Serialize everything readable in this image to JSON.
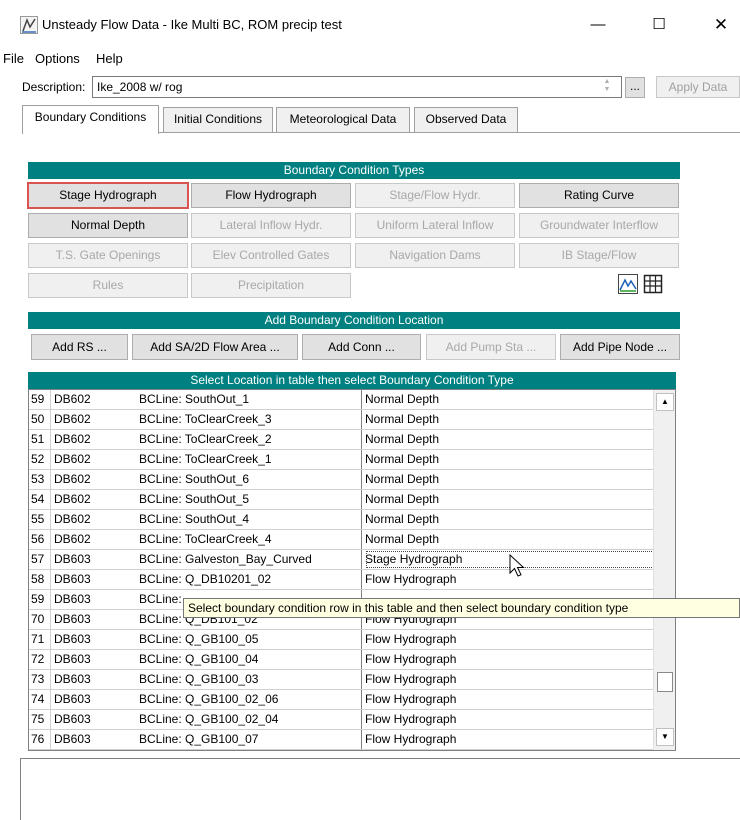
{
  "window": {
    "title": "Unsteady Flow Data - Ike Multi BC, ROM precip test",
    "minimize": "—",
    "maximize": "☐",
    "close": "✕"
  },
  "menu": [
    {
      "label": "File"
    },
    {
      "label": "Options"
    },
    {
      "label": "Help"
    }
  ],
  "description": {
    "label": "Description:",
    "value": "Ike_2008 w/ rog",
    "ellipsis_label": "...",
    "apply_label": "Apply Data"
  },
  "tabs": [
    {
      "label": "Boundary Conditions",
      "active": true
    },
    {
      "label": "Initial Conditions"
    },
    {
      "label": "Meteorological Data"
    },
    {
      "label": "Observed Data"
    }
  ],
  "bc_types": {
    "header": "Boundary Condition Types",
    "buttons": [
      {
        "label": "Stage Hydrograph",
        "enabled": true,
        "selected": true
      },
      {
        "label": "Flow Hydrograph",
        "enabled": true
      },
      {
        "label": "Stage/Flow Hydr.",
        "enabled": false
      },
      {
        "label": "Rating Curve",
        "enabled": true
      },
      {
        "label": "Normal Depth",
        "enabled": true
      },
      {
        "label": "Lateral Inflow Hydr.",
        "enabled": false
      },
      {
        "label": "Uniform Lateral Inflow",
        "enabled": false
      },
      {
        "label": "Groundwater Interflow",
        "enabled": false
      },
      {
        "label": "T.S. Gate Openings",
        "enabled": false
      },
      {
        "label": "Elev Controlled Gates",
        "enabled": false
      },
      {
        "label": "Navigation Dams",
        "enabled": false
      },
      {
        "label": "IB Stage/Flow",
        "enabled": false
      },
      {
        "label": "Rules",
        "enabled": false
      },
      {
        "label": "Precipitation",
        "enabled": false
      }
    ],
    "icons": [
      "hydrograph-plot-icon",
      "table-icon"
    ]
  },
  "add_location": {
    "header": "Add Boundary Condition Location",
    "buttons": [
      {
        "label": "Add RS ...",
        "enabled": true
      },
      {
        "label": "Add SA/2D Flow Area ...",
        "enabled": true
      },
      {
        "label": "Add Conn ...",
        "enabled": true
      },
      {
        "label": "Add Pump Sta ...",
        "enabled": false
      },
      {
        "label": "Add Pipe Node ...",
        "enabled": true
      }
    ]
  },
  "table": {
    "header": "Select Location in table then select Boundary Condition Type",
    "rows": [
      {
        "num": "59",
        "river": "DB602",
        "location": "BCLine: SouthOut_1",
        "bc": "Normal Depth"
      },
      {
        "num": "50",
        "river": "DB602",
        "location": "BCLine: ToClearCreek_3",
        "bc": "Normal Depth"
      },
      {
        "num": "51",
        "river": "DB602",
        "location": "BCLine: ToClearCreek_2",
        "bc": "Normal Depth"
      },
      {
        "num": "52",
        "river": "DB602",
        "location": "BCLine: ToClearCreek_1",
        "bc": "Normal Depth"
      },
      {
        "num": "53",
        "river": "DB602",
        "location": "BCLine: SouthOut_6",
        "bc": "Normal Depth"
      },
      {
        "num": "54",
        "river": "DB602",
        "location": "BCLine: SouthOut_5",
        "bc": "Normal Depth"
      },
      {
        "num": "55",
        "river": "DB602",
        "location": "BCLine: SouthOut_4",
        "bc": "Normal Depth"
      },
      {
        "num": "56",
        "river": "DB602",
        "location": "BCLine: ToClearCreek_4",
        "bc": "Normal Depth"
      },
      {
        "num": "57",
        "river": "DB603",
        "location": "BCLine: Galveston_Bay_Curved",
        "bc": "Stage Hydrograph",
        "highlight": true
      },
      {
        "num": "58",
        "river": "DB603",
        "location": "BCLine: Q_DB10201_02",
        "bc": "Flow Hydrograph"
      },
      {
        "num": "59",
        "river": "DB603",
        "location": "BCLine:",
        "bc": ""
      },
      {
        "num": "70",
        "river": "DB603",
        "location": "BCLine: Q_DB101_02",
        "bc": "Flow Hydrograph"
      },
      {
        "num": "71",
        "river": "DB603",
        "location": "BCLine: Q_GB100_05",
        "bc": "Flow Hydrograph"
      },
      {
        "num": "72",
        "river": "DB603",
        "location": "BCLine: Q_GB100_04",
        "bc": "Flow Hydrograph"
      },
      {
        "num": "73",
        "river": "DB603",
        "location": "BCLine: Q_GB100_03",
        "bc": "Flow Hydrograph"
      },
      {
        "num": "74",
        "river": "DB603",
        "location": "BCLine: Q_GB100_02_06",
        "bc": "Flow Hydrograph"
      },
      {
        "num": "75",
        "river": "DB603",
        "location": "BCLine: Q_GB100_02_04",
        "bc": "Flow Hydrograph"
      },
      {
        "num": "76",
        "river": "DB603",
        "location": "BCLine: Q_GB100_07",
        "bc": "Flow Hydrograph"
      }
    ],
    "scroll_up": "▲",
    "scroll_down": "▼"
  },
  "tooltip": "Select boundary condition row in this table and then select boundary condition type",
  "colors": {
    "section_header": "#008080",
    "selected_outline": "#d9534f",
    "tooltip_bg": "#ffffe1"
  }
}
